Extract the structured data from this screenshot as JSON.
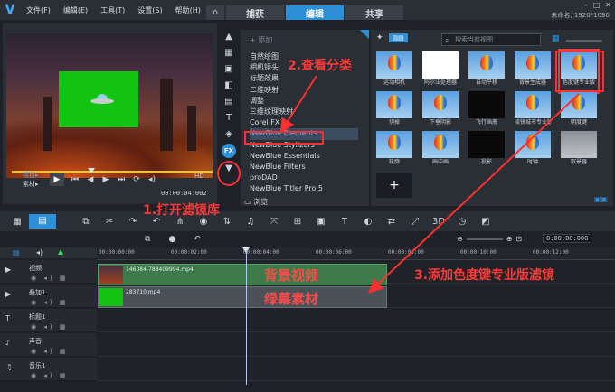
{
  "menu": [
    "文件(F)",
    "编辑(E)",
    "工具(T)",
    "设置(S)",
    "帮助(H)"
  ],
  "modes": {
    "home_icon": "home-icon",
    "tabs": [
      "捕获",
      "编辑",
      "共享"
    ],
    "active": "编辑"
  },
  "project": {
    "info": "未命名, 1920*1080"
  },
  "player": {
    "project_label": "项目▸",
    "clip_label": "素材▸",
    "timecode": "00:00:04:002",
    "hd": "HD"
  },
  "library": {
    "add_label": "+ 添加",
    "browse_label": "浏览",
    "categories": [
      "自然绘图",
      "相机镜头",
      "标题效果",
      "二维映射",
      "调整",
      "三维纹理映射",
      "Corel FX",
      "NewBlue Elements",
      "NewBlue Stylizers",
      "NewBlue Essentials",
      "NewBlue Filters",
      "proDAD",
      "NewBlue Titler Pro 5"
    ],
    "selected_category": "NewBlue Elements",
    "search_placeholder": "搜索当前视图",
    "thumbnails": [
      {
        "label": "运动相机",
        "style": "balloon"
      },
      {
        "label": "阿尔法处理器",
        "style": "white"
      },
      {
        "label": "自动平移",
        "style": "balloon"
      },
      {
        "label": "背景生成器",
        "style": "balloon"
      },
      {
        "label": "色度键专业版",
        "style": "balloon"
      },
      {
        "label": "切掉",
        "style": "balloon"
      },
      {
        "label": "下垂阴影",
        "style": "balloon"
      },
      {
        "label": "飞行画册",
        "style": "black"
      },
      {
        "label": "棱镜城市专业版",
        "style": "balloon"
      },
      {
        "label": "明度键",
        "style": "balloon"
      },
      {
        "label": "轮廓",
        "style": "balloon"
      },
      {
        "label": "画中画",
        "style": "balloon"
      },
      {
        "label": "投影",
        "style": "black"
      },
      {
        "label": "时钟",
        "style": "balloon"
      },
      {
        "label": "取景器",
        "style": "grey"
      }
    ]
  },
  "timeline": {
    "timecode": "0:00:08:000",
    "ruler": [
      "00:00:00:00",
      "00:00:02:00",
      "00:00:04:00",
      "00:00:06:00",
      "00:00:08:00",
      "00:00:10:00",
      "00:00:12:00"
    ],
    "tracks": [
      {
        "name": "视频",
        "icon": "film-icon"
      },
      {
        "name": "叠加1",
        "icon": "overlay-icon"
      },
      {
        "name": "标题1",
        "icon": "title-icon"
      },
      {
        "name": "声音",
        "icon": "voice-icon"
      },
      {
        "name": "音乐1",
        "icon": "music-icon"
      }
    ],
    "clips": [
      {
        "name": "146084-788409994.mp4",
        "track": "视频"
      },
      {
        "name": "283710.mp4",
        "track": "叠加1"
      }
    ]
  },
  "annotations": {
    "step1": "1.打开滤镜库",
    "step2": "2.查看分类",
    "step3": "3.添加色度键专业版滤镜",
    "bg_video": "背景视频",
    "green_screen": "绿幕素材"
  }
}
